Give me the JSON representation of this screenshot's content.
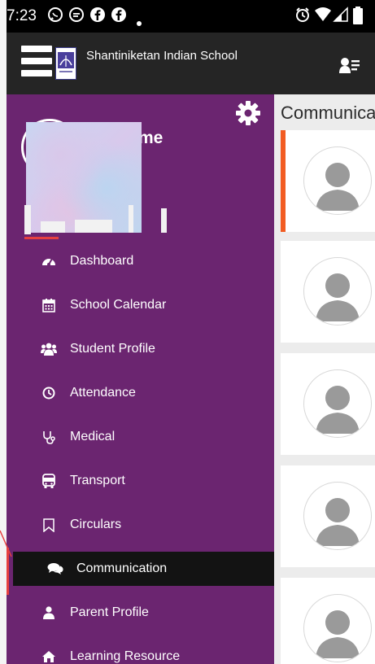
{
  "status_bar": {
    "time": "7:23",
    "icons": [
      "whatsapp-icon",
      "chat-bubble-icon",
      "facebook-icon",
      "facebook-icon",
      "dot-icon",
      "alarm-icon",
      "wifi-icon",
      "signal-icon",
      "battery-icon"
    ]
  },
  "app_bar": {
    "title": "Shantiniketan Indian School",
    "menu_icon": "hamburger-icon",
    "right_icon": "profile-list-icon"
  },
  "drawer": {
    "user_name_fragment": "me",
    "menu": [
      {
        "label": "Dashboard",
        "icon": "tachometer-icon"
      },
      {
        "label": "School Calendar",
        "icon": "calendar-icon"
      },
      {
        "label": "Student Profile",
        "icon": "users-icon"
      },
      {
        "label": "Attendance",
        "icon": "clock-icon"
      },
      {
        "label": "Medical",
        "icon": "stethoscope-icon"
      },
      {
        "label": "Transport",
        "icon": "bus-icon"
      },
      {
        "label": "Circulars",
        "icon": "bookmark-icon"
      },
      {
        "label": "Communication",
        "icon": "comments-icon",
        "active": true
      },
      {
        "label": "Parent Profile",
        "icon": "user-icon"
      },
      {
        "label": "Learning Resource",
        "icon": "home-icon"
      }
    ]
  },
  "content": {
    "title": "Communication"
  },
  "colors": {
    "drawer_bg": "#6b2570",
    "appbar_bg": "#252525",
    "active_item_bg": "#131313",
    "accent_orange": "#f25c22",
    "annotation_red": "#e64040"
  }
}
